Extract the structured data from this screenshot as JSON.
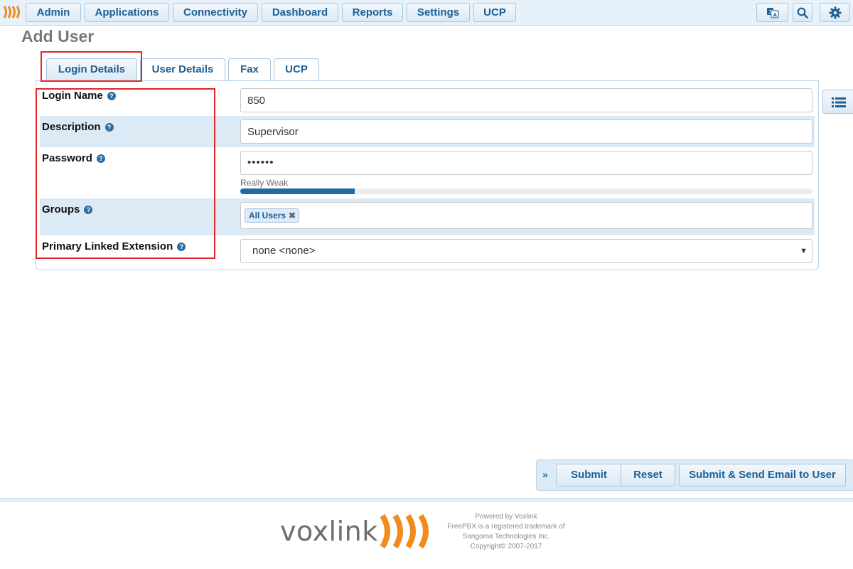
{
  "nav": {
    "items": [
      "Admin",
      "Applications",
      "Connectivity",
      "Dashboard",
      "Reports",
      "Settings",
      "UCP"
    ]
  },
  "icons": {
    "logo": "voxlink-logo-icon",
    "translate": "translate-icon",
    "search": "search-icon",
    "settings": "gear-icon",
    "side_menu": "list-icon",
    "expand": "double-chevron-right-icon"
  },
  "page": {
    "title": "Add User"
  },
  "tabs": [
    {
      "label": "Login Details",
      "active": true
    },
    {
      "label": "User Details",
      "active": false
    },
    {
      "label": "Fax",
      "active": false
    },
    {
      "label": "UCP",
      "active": false
    }
  ],
  "form": {
    "login_name": {
      "label": "Login Name",
      "value": "850"
    },
    "description": {
      "label": "Description",
      "value": "Supervisor"
    },
    "password": {
      "label": "Password",
      "value": "••••••",
      "strength_label": "Really Weak",
      "strength_fraction": 0.2
    },
    "groups": {
      "label": "Groups",
      "selected": [
        "All Users"
      ]
    },
    "primary_linked_extension": {
      "label": "Primary Linked Extension",
      "value": "none <none>"
    }
  },
  "actions": {
    "submit": "Submit",
    "reset": "Reset",
    "submit_email": "Submit & Send Email to User"
  },
  "footer": {
    "brand": "voxlink",
    "lines": [
      "Powered by Voxlink",
      "FreePBX is a registered trademark of",
      "Sangoma Technologies Inc.",
      "Copyright© 2007-2017"
    ]
  },
  "colors": {
    "accent": "#1d5f91",
    "highlight": "#e0262b",
    "band": "#dceaf6",
    "brand_orange": "#f28a1e"
  }
}
